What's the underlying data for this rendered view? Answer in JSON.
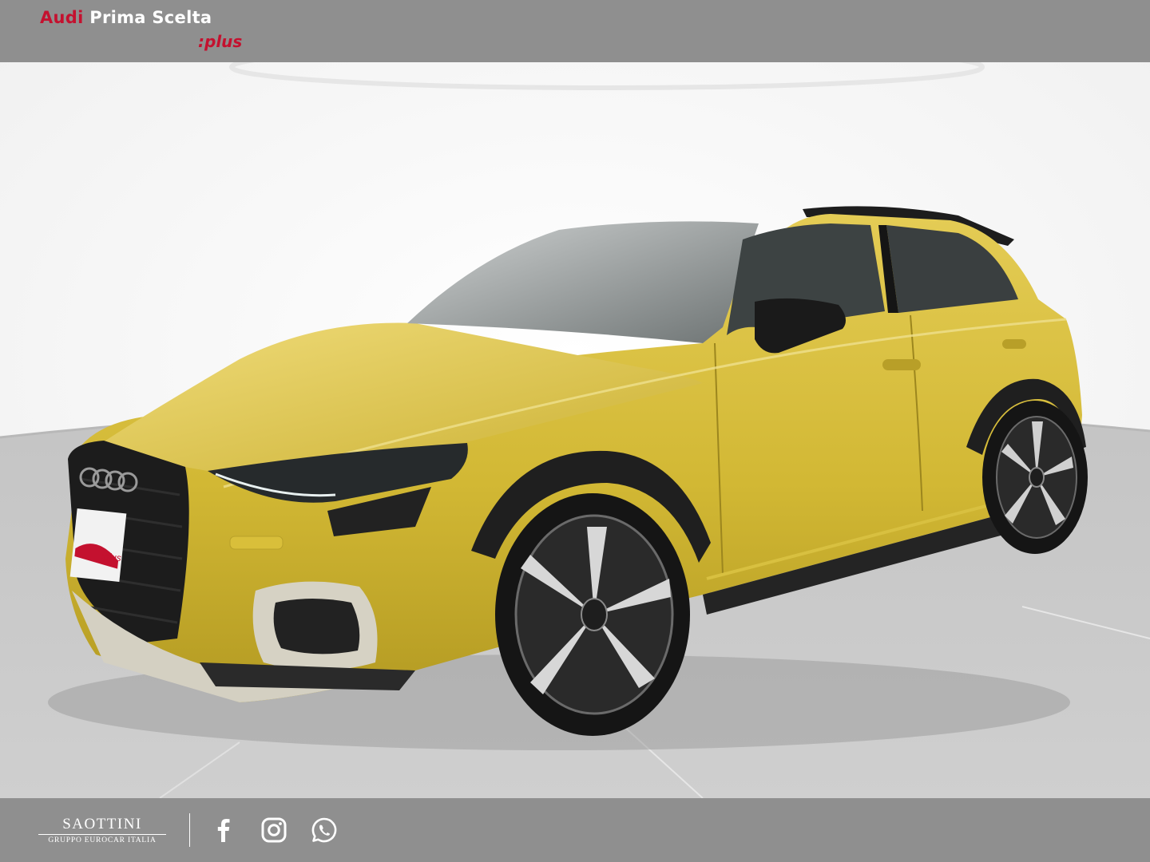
{
  "header": {
    "brand_audi": "Audi",
    "brand_prima": "Prima Scelta",
    "brand_plus": ":plus"
  },
  "vehicle": {
    "plate_text": ":plus",
    "color": "#d4bb33"
  },
  "footer": {
    "dealer_name": "SAOTTINI",
    "dealer_group": "GRUPPO EUROCAR ITALIA",
    "social_icons": [
      "facebook-icon",
      "instagram-icon",
      "whatsapp-icon"
    ]
  },
  "colors": {
    "bar": "#8f8f8f",
    "brand_red": "#c4112f",
    "car_yellow": "#d4bb33"
  }
}
